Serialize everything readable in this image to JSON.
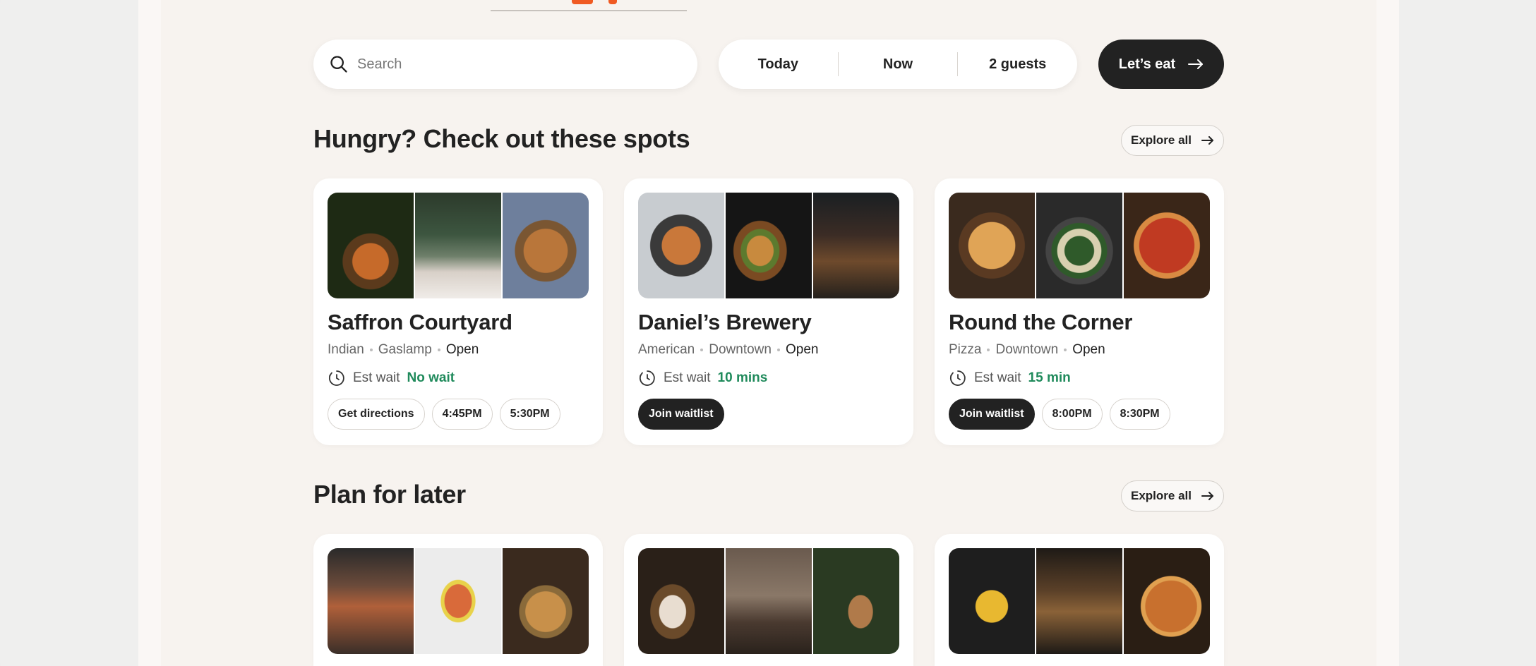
{
  "search": {
    "placeholder": "Search"
  },
  "picker": {
    "date": "Today",
    "time": "Now",
    "guests": "2 guests"
  },
  "cta": {
    "label": "Let’s eat"
  },
  "sections": [
    {
      "title": "Hungry? Check out these spots",
      "explore_label": "Explore all",
      "cards": [
        {
          "name": "Saffron Courtyard",
          "cuisine": "Indian",
          "area": "Gaslamp",
          "status": "Open",
          "wait_label": "Est wait",
          "wait_value": "No wait",
          "actions": [
            "Get directions",
            "4:45PM",
            "5:30PM"
          ]
        },
        {
          "name": "Daniel’s Brewery",
          "cuisine": "American",
          "area": "Downtown",
          "status": "Open",
          "wait_label": "Est wait",
          "wait_value": "10 mins",
          "actions": [
            "Join waitlist"
          ]
        },
        {
          "name": "Round the Corner",
          "cuisine": "Pizza",
          "area": "Downtown",
          "status": "Open",
          "wait_label": "Est wait",
          "wait_value": "15 min",
          "actions": [
            "Join waitlist",
            "8:00PM",
            "8:30PM"
          ]
        }
      ]
    },
    {
      "title": "Plan for later",
      "explore_label": "Explore all"
    }
  ],
  "colors": {
    "accent_orange": "#f05a22",
    "wait_green": "#1f8a5b",
    "dark": "#222222",
    "page_bg": "#f7f3ef"
  },
  "icons": [
    "search-icon",
    "arrow-right-icon",
    "clock-icon"
  ]
}
